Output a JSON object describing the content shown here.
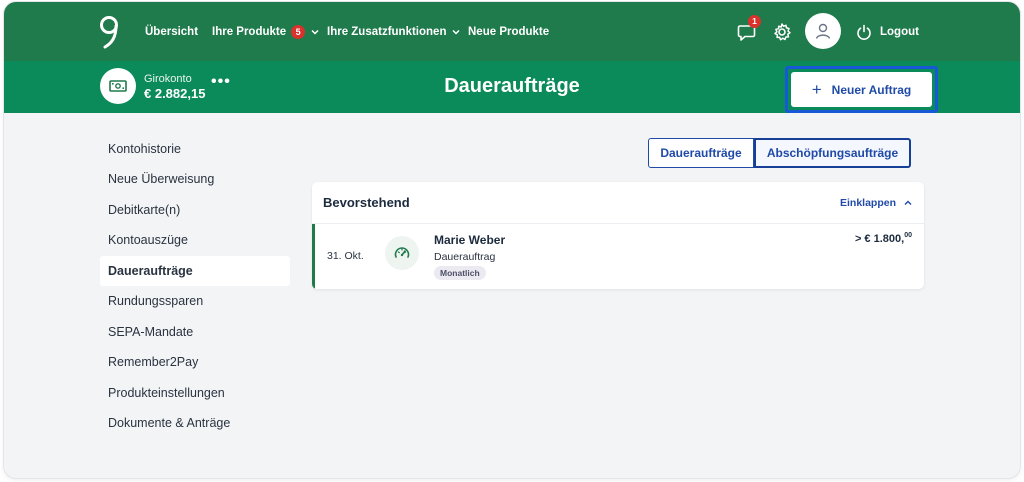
{
  "topnav": {
    "items": [
      {
        "label": "Übersicht"
      },
      {
        "label": "Ihre Produkte",
        "badge": "5"
      },
      {
        "label": "Ihre Zusatzfunktionen"
      },
      {
        "label": "Neue Produkte"
      }
    ],
    "messages_badge": "1",
    "logout_label": "Logout",
    "icons": [
      "brand-logo-icon",
      "chat-icon",
      "gear-icon",
      "user-icon",
      "power-icon",
      "chevron-down-icon"
    ]
  },
  "account": {
    "name": "Girokonto",
    "balance": "€ 2.882,15",
    "more": "•••"
  },
  "page": {
    "title": "Daueraufträge",
    "new_order_label": "Neuer Auftrag",
    "new_order_plus": "+"
  },
  "sidebar": {
    "items": [
      {
        "label": "Kontohistorie"
      },
      {
        "label": "Neue Überweisung"
      },
      {
        "label": "Debitkarte(n)"
      },
      {
        "label": "Kontoauszüge"
      },
      {
        "label": "Daueraufträge",
        "active": true
      },
      {
        "label": "Rundungssparen"
      },
      {
        "label": "SEPA-Mandate"
      },
      {
        "label": "Remember2Pay"
      },
      {
        "label": "Produkteinstellungen"
      },
      {
        "label": "Dokumente & Anträge"
      }
    ]
  },
  "tabs": [
    {
      "label": "Daueraufträge"
    },
    {
      "label": "Abschöpfungsaufträge",
      "active": true
    }
  ],
  "card": {
    "title": "Bevorstehend",
    "collapse_label": "Einklappen",
    "rows": [
      {
        "date": "31. Okt.",
        "name": "Marie Weber",
        "type": "Dauerauftrag",
        "tag": "Monatlich",
        "amount_main": "> € 1.800,",
        "amount_cents": "00"
      }
    ]
  },
  "colors": {
    "nav_green": "#1f7a4c",
    "subhead_green": "#0b8a5a",
    "accent_blue": "#1f4aa8",
    "highlight_blue": "#1758d6",
    "badge_red": "#d9322c"
  }
}
